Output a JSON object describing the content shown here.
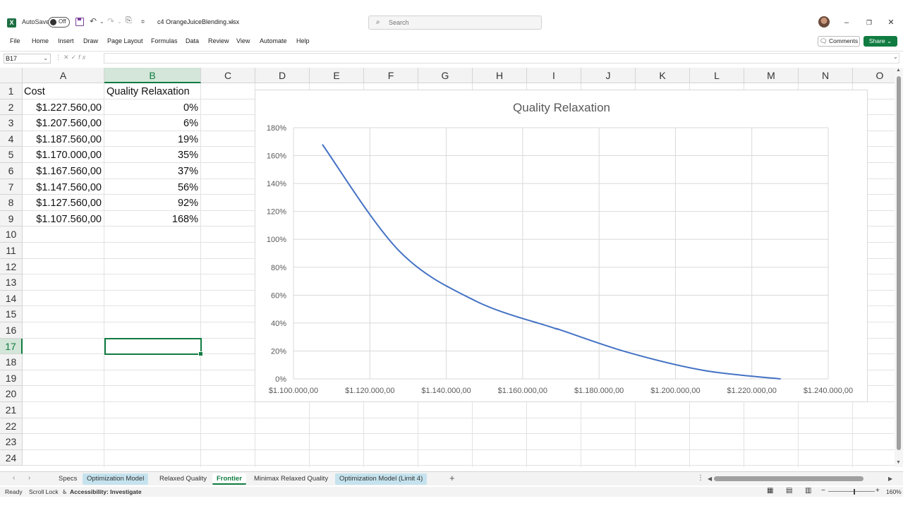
{
  "titlebar": {
    "app_logo": "X",
    "autosave_label": "AutoSave",
    "autosave_state": "Off",
    "filename": "c4 OrangeJuiceBlending.xlsx",
    "search_placeholder": "Search",
    "minimize": "–",
    "restore": "❐",
    "close": "✕"
  },
  "menu": {
    "items": [
      "File",
      "Home",
      "Insert",
      "Draw",
      "Page Layout",
      "Formulas",
      "Data",
      "Review",
      "View",
      "Automate",
      "Help"
    ],
    "comments_label": "Comments",
    "share_label": "Share"
  },
  "formula_bar": {
    "name_box": "B17",
    "fx": "fx",
    "formula": ""
  },
  "grid": {
    "columns": [
      "A",
      "B",
      "C",
      "D",
      "E",
      "F",
      "G",
      "H",
      "I",
      "J",
      "K",
      "L",
      "M",
      "N",
      "O"
    ],
    "rows": [
      "1",
      "2",
      "3",
      "4",
      "5",
      "6",
      "7",
      "8",
      "9",
      "10",
      "11",
      "12",
      "13",
      "14",
      "15",
      "16",
      "17",
      "18",
      "19",
      "20",
      "21",
      "22",
      "23",
      "24"
    ],
    "selected_column": "B",
    "selected_row": "17",
    "header_a": "Cost",
    "header_b": "Quality Relaxation",
    "data": [
      {
        "cost": "$1.227.560,00",
        "quality": "0%"
      },
      {
        "cost": "$1.207.560,00",
        "quality": "6%"
      },
      {
        "cost": "$1.187.560,00",
        "quality": "19%"
      },
      {
        "cost": "$1.170.000,00",
        "quality": "35%"
      },
      {
        "cost": "$1.167.560,00",
        "quality": "37%"
      },
      {
        "cost": "$1.147.560,00",
        "quality": "56%"
      },
      {
        "cost": "$1.127.560,00",
        "quality": "92%"
      },
      {
        "cost": "$1.107.560,00",
        "quality": "168%"
      }
    ]
  },
  "chart_data": {
    "type": "scatter",
    "title": "Quality Relaxation",
    "xlabel": "",
    "ylabel": "",
    "xlim": [
      1100000,
      1240000
    ],
    "ylim": [
      0,
      180
    ],
    "x_ticks": [
      "$1.100.000,00",
      "$1.120.000,00",
      "$1.140.000,00",
      "$1.160.000,00",
      "$1.180.000,00",
      "$1.200.000,00",
      "$1.220.000,00",
      "$1.240.000,00"
    ],
    "y_ticks": [
      "0%",
      "20%",
      "40%",
      "60%",
      "80%",
      "100%",
      "120%",
      "140%",
      "160%",
      "180%"
    ],
    "grid": true,
    "smooth_lines": true,
    "line_color": "#4472c4",
    "series": [
      {
        "x": [
          1107560,
          1127560,
          1147560,
          1167560,
          1170000,
          1187560,
          1207560,
          1227560
        ],
        "y": [
          168,
          92,
          56,
          37,
          35,
          19,
          6,
          0
        ]
      }
    ]
  },
  "sheets": {
    "tabs": [
      {
        "label": "Specs",
        "style": "plain"
      },
      {
        "label": "Optimization Model",
        "style": "colored"
      },
      {
        "label": "Relaxed Quality",
        "style": "plain"
      },
      {
        "label": "Frontier",
        "style": "active"
      },
      {
        "label": "Minimax Relaxed Quality",
        "style": "plain"
      },
      {
        "label": "Optimization Model (Limit 4)",
        "style": "colored"
      }
    ],
    "add": "+"
  },
  "status": {
    "ready": "Ready",
    "scroll_lock": "Scroll Lock",
    "accessibility": "Accessibility: Investigate",
    "zoom": "160%"
  },
  "colors": {
    "accent": "#107c41",
    "series": "#4472c4"
  }
}
